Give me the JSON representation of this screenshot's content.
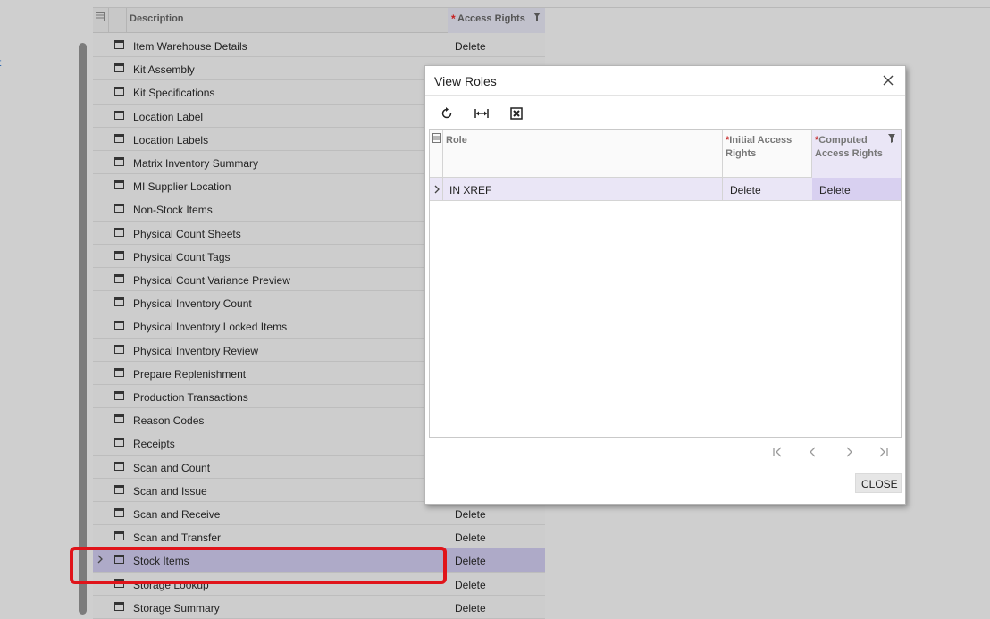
{
  "left_panel": {
    "link_fragment": "t"
  },
  "grid": {
    "headers": {
      "description": "Description",
      "access_rights": "Access Rights",
      "required_mark": "*"
    },
    "rows": [
      {
        "description": "Item Warehouse Details",
        "rights": "Delete"
      },
      {
        "description": "Kit Assembly",
        "rights": ""
      },
      {
        "description": "Kit Specifications",
        "rights": ""
      },
      {
        "description": "Location Label",
        "rights": ""
      },
      {
        "description": "Location Labels",
        "rights": ""
      },
      {
        "description": "Matrix Inventory Summary",
        "rights": ""
      },
      {
        "description": "MI Supplier Location",
        "rights": ""
      },
      {
        "description": "Non-Stock Items",
        "rights": ""
      },
      {
        "description": "Physical Count Sheets",
        "rights": ""
      },
      {
        "description": "Physical Count Tags",
        "rights": ""
      },
      {
        "description": "Physical Count Variance Preview",
        "rights": ""
      },
      {
        "description": "Physical Inventory Count",
        "rights": ""
      },
      {
        "description": "Physical Inventory Locked Items",
        "rights": ""
      },
      {
        "description": "Physical Inventory Review",
        "rights": ""
      },
      {
        "description": "Prepare Replenishment",
        "rights": ""
      },
      {
        "description": "Production Transactions",
        "rights": ""
      },
      {
        "description": "Reason Codes",
        "rights": ""
      },
      {
        "description": "Receipts",
        "rights": ""
      },
      {
        "description": "Scan and Count",
        "rights": ""
      },
      {
        "description": "Scan and Issue",
        "rights": ""
      },
      {
        "description": "Scan and Receive",
        "rights": "Delete"
      },
      {
        "description": "Scan and Transfer",
        "rights": "Delete"
      },
      {
        "description": "Stock Items",
        "rights": "Delete",
        "selected": true
      },
      {
        "description": "Storage Lookup",
        "rights": "Delete"
      },
      {
        "description": "Storage Summary",
        "rights": "Delete"
      }
    ]
  },
  "modal": {
    "title": "View Roles",
    "toolbar": {
      "refresh_icon": "refresh-icon",
      "fit_icon": "fit-width-icon",
      "excel_icon": "export-excel-icon"
    },
    "table": {
      "headers": {
        "role": "Role",
        "initial": "Initial Access Rights",
        "computed": "Computed Access Rights",
        "required_mark": "*"
      },
      "rows": [
        {
          "role": "IN XREF",
          "initial": "Delete",
          "computed": "Delete"
        }
      ]
    },
    "close_label": "CLOSE"
  },
  "colors": {
    "accent_selected": "#aeaac8",
    "highlight_red": "#e0141a",
    "required_star": "#c62020"
  }
}
